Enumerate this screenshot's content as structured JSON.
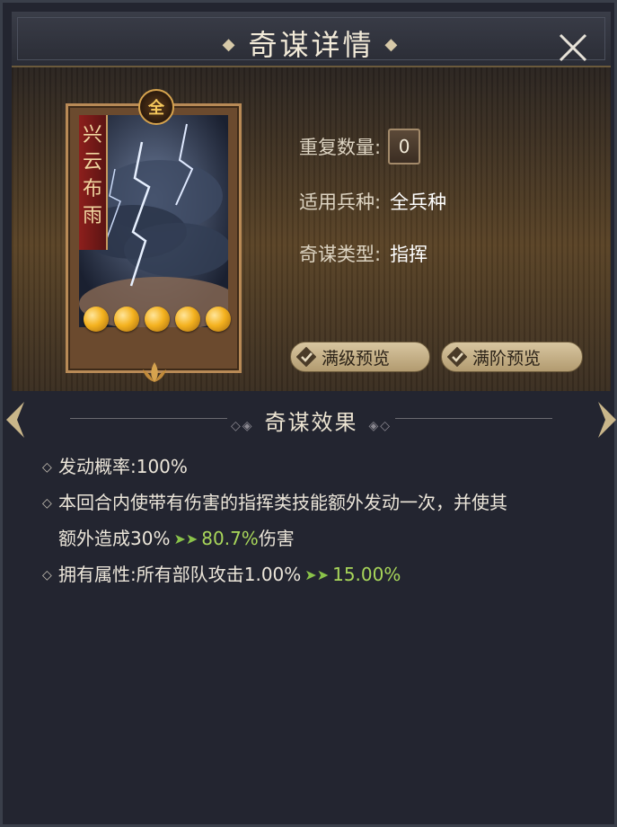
{
  "header": {
    "title": "奇谋详情"
  },
  "card": {
    "name_chars": [
      "兴",
      "云",
      "布",
      "雨"
    ],
    "tier_badge": "全",
    "star_count": 5
  },
  "info": {
    "repeat_label": "重复数量:",
    "repeat_value": "0",
    "troop_label": "适用兵种:",
    "troop_value": "全兵种",
    "type_label": "奇谋类型:",
    "type_value": "指挥"
  },
  "buttons": {
    "max_level_preview": "满级预览",
    "max_rank_preview": "满阶预览"
  },
  "effects_section": {
    "title": "奇谋效果",
    "chance_text": "发动概率:100%",
    "effect_line1": "本回合内使带有伤害的指挥类技能额外发动一次，并使其",
    "effect_line2_pre": "额外造成30%",
    "effect_line2_green": "80.7%",
    "effect_line2_post": "伤害",
    "attr_pre": "拥有属性:所有部队攻击1.00%",
    "attr_green": "15.00%"
  },
  "colors": {
    "accent_gold": "#d6a34e",
    "upgrade_green": "#a8d65a",
    "ribbon_red": "#8d1f1c"
  }
}
